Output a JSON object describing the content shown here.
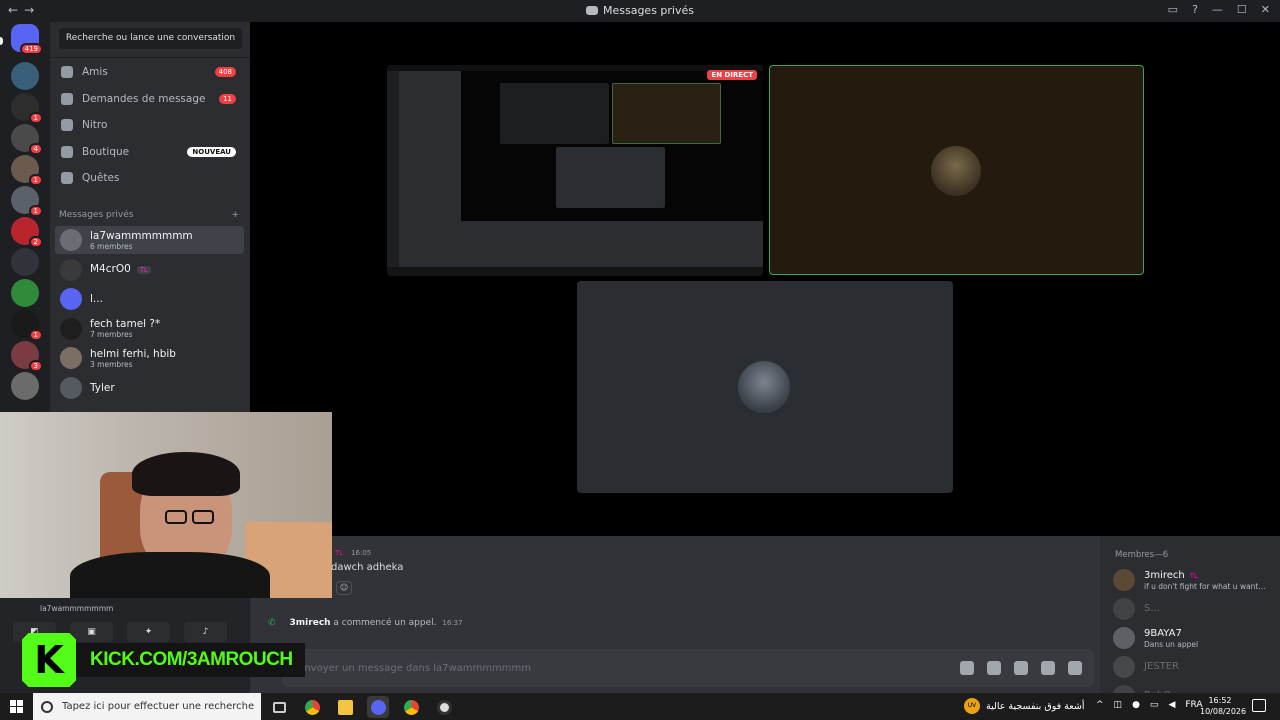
{
  "window": {
    "title": "Messages privés"
  },
  "rail": {
    "home_badge": "419",
    "servers": [
      {
        "color": "#3a5f7a",
        "badge": ""
      },
      {
        "color": "#2d2d2d",
        "badge": "1"
      },
      {
        "color": "#4a4a4a",
        "badge": "4"
      },
      {
        "color": "#6b5a4e",
        "badge": "1"
      },
      {
        "color": "#5b6168",
        "badge": "1"
      },
      {
        "color": "#b8252d",
        "badge": "2"
      },
      {
        "color": "#30343a",
        "badge": ""
      },
      {
        "color": "#2f8a3a",
        "badge": ""
      },
      {
        "color": "#1a1a1a",
        "badge": "1"
      },
      {
        "color": "#7a3b42",
        "badge": "3"
      },
      {
        "color": "#6b6b6b",
        "badge": ""
      }
    ]
  },
  "sidebar": {
    "search_label": "Recherche ou lance une conversation",
    "nav": [
      {
        "label": "Amis",
        "count": "408",
        "new": ""
      },
      {
        "label": "Demandes de message",
        "count": "11",
        "new": ""
      },
      {
        "label": "Nitro",
        "count": "",
        "new": ""
      },
      {
        "label": "Boutique",
        "count": "",
        "new": "NOUVEAU"
      },
      {
        "label": "Quêtes",
        "count": "",
        "new": ""
      }
    ],
    "dm_header": "Messages privés",
    "dm_add": "+",
    "dms": [
      {
        "name": "la7wammmmmmm",
        "sub": "6 membres",
        "tag": "",
        "color": "#6a6e74"
      },
      {
        "name": "M4crO0",
        "sub": "",
        "tag": "TL",
        "color": "#3a3a3a"
      },
      {
        "name": "l...",
        "sub": "",
        "tag": "",
        "color": "#5865f2"
      },
      {
        "name": "fech tamel ?*",
        "sub": "7 membres",
        "tag": "",
        "color": "#1e1e1e"
      },
      {
        "name": "helmi ferhi, hbib",
        "sub": "3 membres",
        "tag": "",
        "color": "#7b6f63"
      },
      {
        "name": "Tyler",
        "sub": "",
        "tag": "",
        "color": "#555a60"
      }
    ]
  },
  "call": {
    "live_label": "EN DIRECT"
  },
  "chat": {
    "msg_tag": "TL",
    "msg_time": "16:05",
    "msg_text": "dawch adheka",
    "sys_user": "3mirech",
    "sys_text": " a commencé un appel.",
    "sys_time": "16:37",
    "placeholder": "Envoyer un message dans la7wammmmmmm"
  },
  "voice": {
    "channel": "la7wammmmmmm"
  },
  "members": {
    "header": "Membres—6",
    "list": [
      {
        "name": "3mirech",
        "status": "if u don't fight for what u want...",
        "tag": "TL",
        "dim": false,
        "color": "#5a4a35"
      },
      {
        "name": "S...",
        "status": "",
        "tag": "",
        "dim": true,
        "color": "#777"
      },
      {
        "name": "9BAYA7",
        "status": "Dans un appel",
        "tag": "",
        "dim": false,
        "color": "#5d6166"
      },
      {
        "name": "JESTER",
        "status": "",
        "tag": "",
        "dim": true,
        "color": "#888"
      },
      {
        "name": "RabO",
        "status": "",
        "tag": "",
        "dim": true,
        "color": "#777"
      }
    ]
  },
  "overlay": {
    "kick_letter": "K",
    "kick_url": "KICK.COM/3AMROUCH"
  },
  "taskbar": {
    "search_placeholder": "Tapez ici pour effectuer une recherche",
    "weather_text": "أشعة فوق بنفسجية عالية",
    "weather_badge": "UV",
    "lang": "FRA",
    "time": "16:52",
    "date": "10/08/2026"
  }
}
